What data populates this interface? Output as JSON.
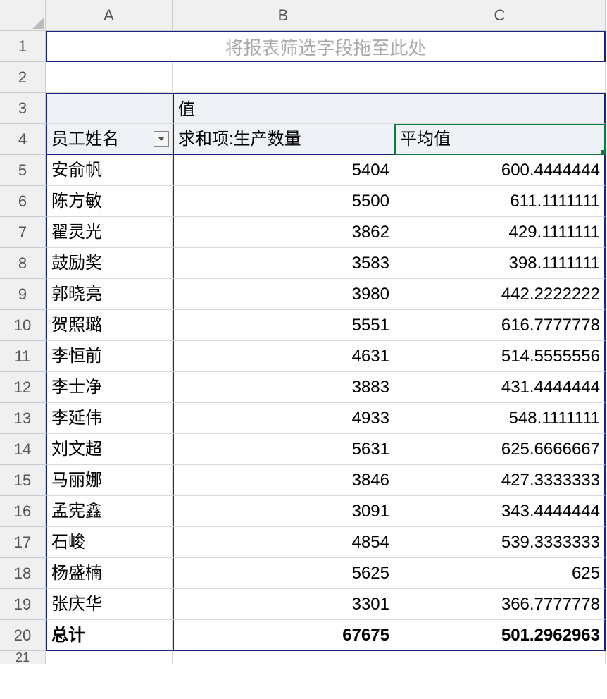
{
  "columns": [
    "A",
    "B",
    "C"
  ],
  "filter_placeholder": "将报表筛选字段拖至此处",
  "values_label": "值",
  "row_field_label": "员工姓名",
  "col_headers": {
    "sum": "求和项:生产数量",
    "avg": "平均值"
  },
  "rows": [
    {
      "n": "5",
      "name": "安俞帆",
      "sum": "5404",
      "avg": "600.4444444"
    },
    {
      "n": "6",
      "name": "陈方敏",
      "sum": "5500",
      "avg": "611.1111111"
    },
    {
      "n": "7",
      "name": "翟灵光",
      "sum": "3862",
      "avg": "429.1111111"
    },
    {
      "n": "8",
      "name": "鼓励奖",
      "sum": "3583",
      "avg": "398.1111111"
    },
    {
      "n": "9",
      "name": "郭晓亮",
      "sum": "3980",
      "avg": "442.2222222"
    },
    {
      "n": "10",
      "name": "贺照璐",
      "sum": "5551",
      "avg": "616.7777778"
    },
    {
      "n": "11",
      "name": "李恒前",
      "sum": "4631",
      "avg": "514.5555556"
    },
    {
      "n": "12",
      "name": "李士净",
      "sum": "3883",
      "avg": "431.4444444"
    },
    {
      "n": "13",
      "name": "李延伟",
      "sum": "4933",
      "avg": "548.1111111"
    },
    {
      "n": "14",
      "name": "刘文超",
      "sum": "5631",
      "avg": "625.6666667"
    },
    {
      "n": "15",
      "name": "马丽娜",
      "sum": "3846",
      "avg": "427.3333333"
    },
    {
      "n": "16",
      "name": "孟宪鑫",
      "sum": "3091",
      "avg": "343.4444444"
    },
    {
      "n": "17",
      "name": "石峻",
      "sum": "4854",
      "avg": "539.3333333"
    },
    {
      "n": "18",
      "name": "杨盛楠",
      "sum": "5625",
      "avg": "625"
    },
    {
      "n": "19",
      "name": "张庆华",
      "sum": "3301",
      "avg": "366.7777778"
    }
  ],
  "total": {
    "label": "总计",
    "sum": "67675",
    "avg": "501.2962963"
  }
}
